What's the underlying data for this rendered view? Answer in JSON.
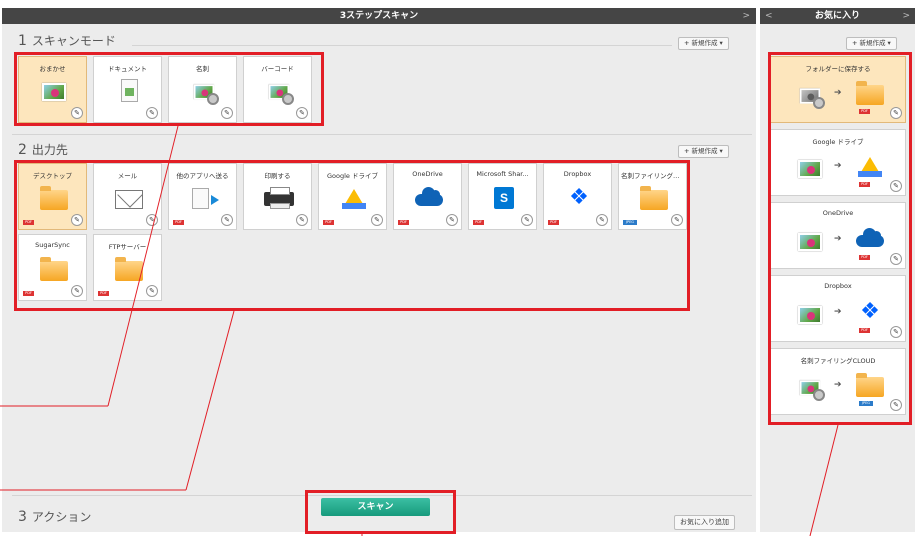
{
  "window": {
    "title": "3ステップスキャン",
    "collapse_arrow": ">"
  },
  "sections": {
    "scan_mode": {
      "number": "1",
      "label": "スキャンモード",
      "new_button": "新規作成 ▾"
    },
    "output": {
      "number": "2",
      "label": "出力先",
      "new_button": "新規作成 ▾"
    },
    "action": {
      "number": "3",
      "label": "アクション"
    }
  },
  "scan_modes": [
    {
      "label": "おまかせ",
      "icon": "photo-icon",
      "selected": true
    },
    {
      "label": "ドキュメント",
      "icon": "document-icon",
      "selected": false
    },
    {
      "label": "名刺",
      "icon": "business-card-icon",
      "selected": false
    },
    {
      "label": "バーコード",
      "icon": "barcode-icon",
      "selected": false
    }
  ],
  "outputs": [
    {
      "label": "デスクトップ",
      "icon": "folder-icon",
      "selected": true,
      "badge": "PDF"
    },
    {
      "label": "メール",
      "icon": "mail-icon",
      "selected": false,
      "badge": ""
    },
    {
      "label": "他のアプリへ送る",
      "icon": "send-to-app-icon",
      "selected": false,
      "badge": "PDF"
    },
    {
      "label": "印刷する",
      "icon": "printer-icon",
      "selected": false,
      "badge": ""
    },
    {
      "label": "Google ドライブ",
      "icon": "google-drive-icon",
      "selected": false,
      "badge": "PDF"
    },
    {
      "label": "OneDrive",
      "icon": "onedrive-icon",
      "selected": false,
      "badge": "PDF"
    },
    {
      "label": "Microsoft Shar...",
      "icon": "sharepoint-icon",
      "selected": false,
      "badge": "PDF"
    },
    {
      "label": "Dropbox",
      "icon": "dropbox-icon",
      "selected": false,
      "badge": "PDF"
    },
    {
      "label": "名刺ファイリングCL...",
      "icon": "folder-icon",
      "selected": false,
      "badge": "JPEG"
    },
    {
      "label": "SugarSync",
      "icon": "folder-icon",
      "selected": false,
      "badge": "PDF"
    },
    {
      "label": "FTPサーバー",
      "icon": "folder-icon",
      "selected": false,
      "badge": "PDF"
    }
  ],
  "action": {
    "scan_button": "スキャン",
    "add_favorite_button": "お気に入り追加"
  },
  "favorites": {
    "title": "お気に入り",
    "left_arrow": "<",
    "right_arrow": ">",
    "new_button": "新規作成 ▾",
    "items": [
      {
        "label": "フォルダーに保存する",
        "destination_icon": "folder-icon",
        "selected": true,
        "badge": "PDF"
      },
      {
        "label": "Google ドライブ",
        "destination_icon": "google-drive-icon",
        "selected": false,
        "badge": "PDF"
      },
      {
        "label": "OneDrive",
        "destination_icon": "onedrive-icon",
        "selected": false,
        "badge": "PDF"
      },
      {
        "label": "Dropbox",
        "destination_icon": "dropbox-icon",
        "selected": false,
        "badge": "PDF"
      },
      {
        "label": "名刺ファイリングCLOUD",
        "destination_icon": "folder-icon",
        "selected": false,
        "badge": "JPEG"
      }
    ]
  },
  "colors": {
    "highlight": "#e21e26",
    "selected_tile": "#fde6bd",
    "scan_button": "#1fa888",
    "titlebar": "#454545"
  }
}
